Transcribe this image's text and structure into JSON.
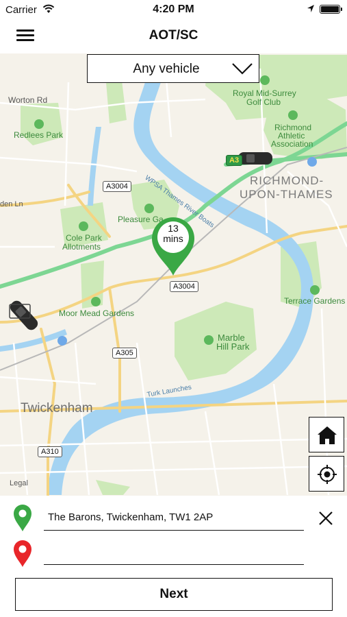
{
  "status_bar": {
    "carrier": "Carrier",
    "time": "4:20 PM"
  },
  "header": {
    "title": "AOT/SC"
  },
  "vehicle_filter": {
    "selected": "Any vehicle"
  },
  "map": {
    "eta_value": "13",
    "eta_unit": "mins",
    "labels": {
      "worton_rd": "Worton Rd",
      "redlees_park": "Redlees Park",
      "royal_mid_surrey_1": "Royal Mid-Surrey",
      "royal_mid_surrey_2": "Golf Club",
      "richmond_athletic_1": "Richmond",
      "richmond_athletic_2": "Athletic",
      "richmond_athletic_3": "Association",
      "richmond_1": "RICHMOND-",
      "richmond_2": "UPON-THAMES",
      "a3004_north": "A3004",
      "a3": "A3",
      "wpsa": "WPSA Thames River Boats",
      "den_ln": "den Ln",
      "pleasure_gardens": "Pleasure Ga",
      "cole_park_1": "Cole Park",
      "cole_park_2": "Allotments",
      "a3004_south": "A3004",
      "moor_mead": "Moor Mead Gardens",
      "terrace_gardens": "Terrace Gardens",
      "marble_hill_1": "Marble",
      "marble_hill_2": "Hill Park",
      "a305": "A305",
      "turk_launches": "Turk Launches",
      "twickenham": "Twickenham",
      "a310": "A310",
      "legal": "Legal"
    }
  },
  "pickup": {
    "address": "The Barons, Twickenham, TW1 2AP"
  },
  "dropoff": {
    "address": ""
  },
  "actions": {
    "next_label": "Next"
  },
  "colors": {
    "pickup_pin": "#3aa845",
    "dropoff_pin": "#e8262a",
    "park": "#cde9b8",
    "water": "#a4d3f2"
  }
}
